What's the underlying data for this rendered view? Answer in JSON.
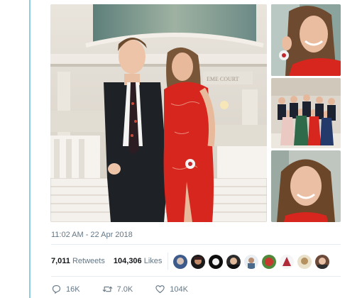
{
  "tweet": {
    "timestamp": "11:02 AM - 22 Apr 2018",
    "photo_sign_text": "EME COURT"
  },
  "stats": {
    "retweets_count": "7,011",
    "retweets_label": "Retweets",
    "likes_count": "104,306",
    "likes_label": "Likes"
  },
  "liked_by_avatars": [
    {
      "icon": "avatar-1"
    },
    {
      "icon": "avatar-2"
    },
    {
      "icon": "avatar-3"
    },
    {
      "icon": "avatar-4"
    },
    {
      "icon": "avatar-5"
    },
    {
      "icon": "avatar-6"
    },
    {
      "icon": "avatar-7"
    },
    {
      "icon": "avatar-8"
    },
    {
      "icon": "avatar-9"
    }
  ],
  "actions": {
    "reply_count": "16K",
    "retweet_count": "7.0K",
    "like_count": "104K"
  },
  "colors": {
    "accent": "#1da1f2",
    "dress_red": "#d7261e",
    "border_blue": "#8fcbe9",
    "muted_text": "#657786"
  }
}
